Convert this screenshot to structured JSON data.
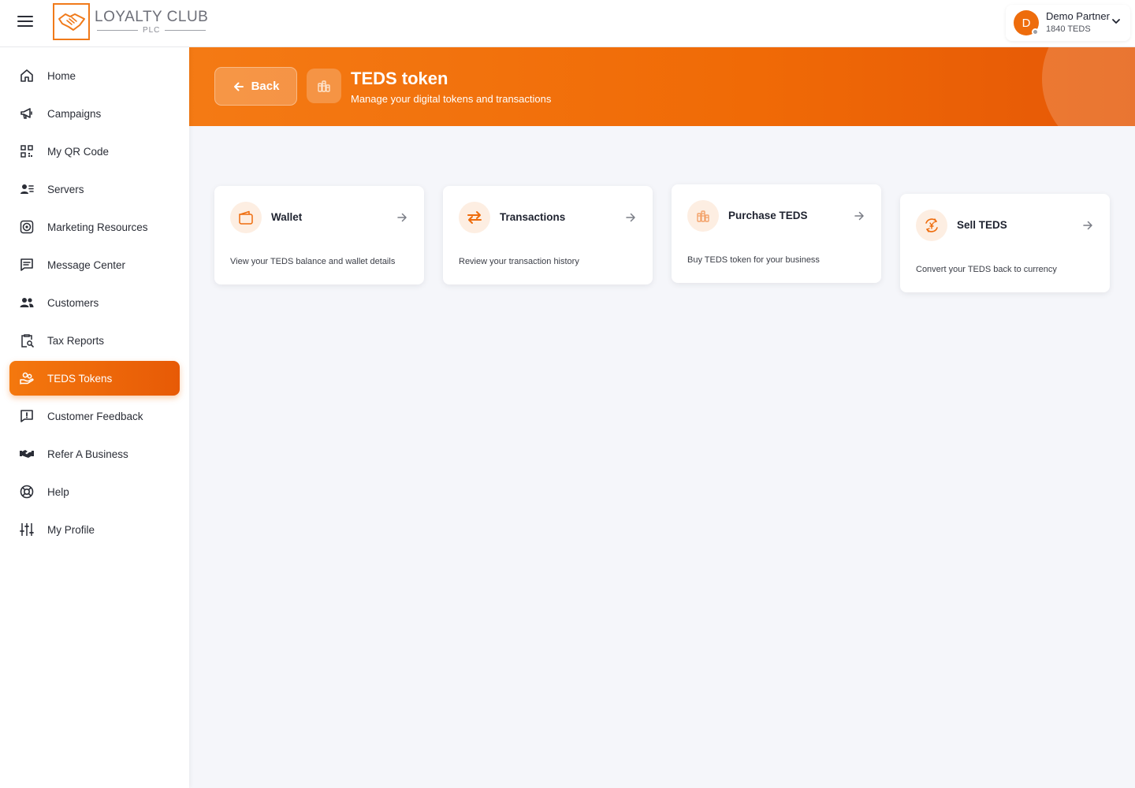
{
  "brand": {
    "title": "LOYALTY CLUB",
    "subtitle": "PLC"
  },
  "user": {
    "initial": "D",
    "name": "Demo Partner",
    "balance": "1840 TEDS"
  },
  "sidebar": {
    "items": [
      {
        "label": "Home",
        "icon": "home-icon"
      },
      {
        "label": "Campaigns",
        "icon": "megaphone-icon"
      },
      {
        "label": "My QR Code",
        "icon": "qr-code-icon"
      },
      {
        "label": "Servers",
        "icon": "user-list-icon"
      },
      {
        "label": "Marketing Resources",
        "icon": "target-icon"
      },
      {
        "label": "Message Center",
        "icon": "message-icon"
      },
      {
        "label": "Customers",
        "icon": "users-icon"
      },
      {
        "label": "Tax Reports",
        "icon": "clipboard-search-icon"
      },
      {
        "label": "TEDS Tokens",
        "icon": "coins-hand-icon",
        "active": true
      },
      {
        "label": "Customer Feedback",
        "icon": "feedback-icon"
      },
      {
        "label": "Refer A Business",
        "icon": "handshake-icon"
      },
      {
        "label": "Help",
        "icon": "lifebuoy-icon"
      },
      {
        "label": "My Profile",
        "icon": "sliders-icon"
      }
    ]
  },
  "banner": {
    "back_label": "Back",
    "title": "TEDS token",
    "subtitle": "Manage your digital tokens and transactions"
  },
  "cards": [
    {
      "title": "Wallet",
      "description": "View your TEDS balance and wallet details",
      "icon": "wallet-icon"
    },
    {
      "title": "Transactions",
      "description": "Review your transaction history",
      "icon": "swap-arrows-icon"
    },
    {
      "title": "Purchase TEDS",
      "description": "Buy TEDS token for your business",
      "icon": "coins-icon"
    },
    {
      "title": "Sell TEDS",
      "description": "Convert your TEDS back to currency",
      "icon": "currency-exchange-icon"
    }
  ],
  "colors": {
    "accent": "#ee6c0c",
    "accent_light": "#fdeee2",
    "background": "#f5f6fa"
  }
}
